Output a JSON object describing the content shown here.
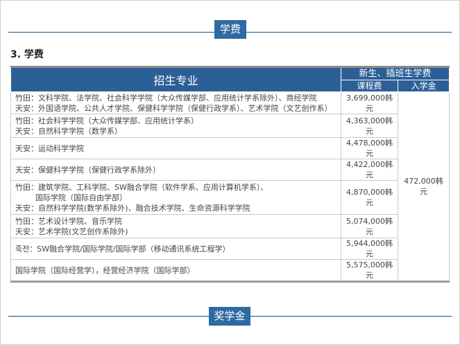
{
  "section_top": {
    "title": "学费"
  },
  "heading": "3. 学费",
  "table": {
    "header_major": "招生专业",
    "header_group": "新生、插班生学费",
    "header_tuition": "课程费",
    "header_entrance": "入学金",
    "entrance_fee": "472,000韩元",
    "rows": [
      {
        "lines": [
          "竹田：文科学院、法学院、社会科学学院（大众传媒学部、应用统计学系除外）、商经学院",
          "天安：外国语学院、公共人才学院、保健科学学院（保健行政学系）、艺术学院（文艺创作系）"
        ],
        "fee": "3,699,000韩元"
      },
      {
        "lines": [
          "竹田：社会科学学院（大众传媒学部、应用统计学系）",
          "天安：自然科学学院（数学系）"
        ],
        "fee": "4,363,000韩元"
      },
      {
        "lines": [
          "天安：运动科学学院"
        ],
        "fee": "4,478,000韩元"
      },
      {
        "lines": [
          "天安：保健科学学院（保健行政学系除外）"
        ],
        "fee": "4,422,000韩元"
      },
      {
        "lines": [
          "竹田：建筑学院、工科学院、SW融合学院（软件学系、应用计算机学系）、",
          "国际学院（国际自由学部）",
          "天安：自然科学学院(数学系除外)、融合技术学院、生命资源科学学院"
        ],
        "fee": "4,870,000韩元"
      },
      {
        "lines": [
          "竹田：艺术设计学院、音乐学院",
          "天安：艺术学院(文艺创作系除外)"
        ],
        "fee": "5,074,000韩元"
      },
      {
        "lines": [
          "죽전：SW融合学院/国际学院/国际学部（移动通讯系统工程学）"
        ],
        "fee": "5,944,000韩元"
      },
      {
        "lines": [
          "国际学院（国际经营学），经营经济学院（国际学部）"
        ],
        "fee": "5,575,000韩元"
      }
    ]
  },
  "section_bottom": {
    "title": "奖学金"
  }
}
